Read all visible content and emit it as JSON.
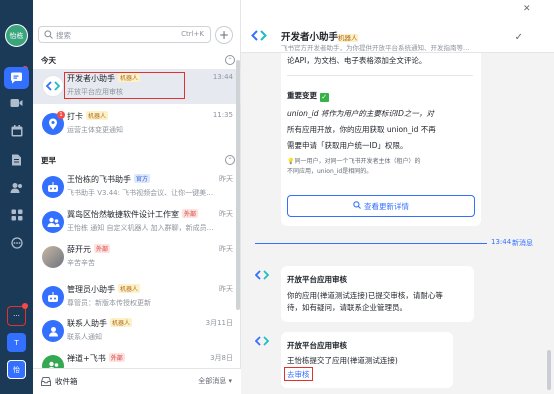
{
  "rail": {
    "avatar_text": "怡栋",
    "tile_t": "T",
    "tile_user": "怡"
  },
  "search": {
    "placeholder": "搜索",
    "shortcut": "Ctrl+K"
  },
  "sections": {
    "today": "今天",
    "earlier": "更早"
  },
  "conversations": [
    {
      "name": "开发者小助手",
      "tag": "机器人",
      "tag_type": "bot",
      "subtitle": "开放平台应用审核",
      "time": "13:44",
      "avatar_color": "#ffffff",
      "icon": "dev-assistant-logo-icon",
      "selected": true
    },
    {
      "name": "打卡",
      "tag": "机器人",
      "tag_type": "bot",
      "subtitle": "运营主体变更通知",
      "time": "11:35",
      "avatar_color": "#3370ff",
      "icon": "checkin-pin-icon",
      "badge": "1"
    },
    {
      "name": "王怡栋的飞书助手",
      "tag": "官方",
      "tag_type": "official",
      "subtitle": "飞书助手 V3.44: 飞书视频会议、让你一键美…",
      "time": "昨天",
      "avatar_color": "#3370ff",
      "icon": "robot-icon"
    },
    {
      "name": "冀岛区怡然敏捷软件设计工作室",
      "tag": "外部",
      "tag_type": "external",
      "subtitle": "王怡栋 通知 自定义机器人 加入群聊，新成员…",
      "time": "昨天",
      "avatar_color": "#3370ff",
      "icon": "group-icon"
    },
    {
      "name": "薛开元",
      "tag": "外部",
      "tag_type": "external",
      "subtitle": "辛苦辛苦",
      "time": "昨天",
      "avatar_color": "#8a8f99",
      "icon": "person-photo-icon"
    },
    {
      "name": "管理员小助手",
      "tag": "机器人",
      "tag_type": "bot",
      "subtitle": "尊管员：新版本传授权更新",
      "time": "昨天",
      "avatar_color": "#3370ff",
      "icon": "admin-robot-icon"
    },
    {
      "name": "联系人助手",
      "tag": "机器人",
      "tag_type": "bot",
      "subtitle": "联系人通知",
      "time": "3月11日",
      "avatar_color": "#3370ff",
      "icon": "contacts-icon"
    },
    {
      "name": "禅道+飞书",
      "tag": "外部",
      "tag_type": "external",
      "subtitle": "",
      "time": "3月8日",
      "avatar_color": "#34a853",
      "icon": "group-icon"
    }
  ],
  "footer": {
    "left": "收件箱",
    "right": "全部消息 ▾"
  },
  "chat": {
    "name": "开发者小助手",
    "tag": "机器人",
    "description": "飞书官方开发者助手，为你提供开放平台系统通知、开发指南等…"
  },
  "card1": {
    "line_top": "论API，为文档、电子表格添加全文评论。",
    "heading": "重要变更",
    "body_lines": [
      "union_id 将作为用户的主要标识ID之一，对",
      "所有应用开放，你的应用获取 union_id 不再",
      "需要申请「获取用户统一ID」权限。"
    ],
    "note_lines": [
      "💡同一用户，对同一个飞书开发者主体（租户）的",
      "不同应用，union_id是相同的。"
    ],
    "button": "查看更新详情"
  },
  "divider": {
    "time": "13:44",
    "label": "新消息"
  },
  "card2": {
    "title": "开放平台应用审核",
    "body_lines": [
      "你的应用(禅道测试连接)已提交审核，请耐心等",
      "待，如有疑问，请联系企业管理员。"
    ]
  },
  "card3": {
    "title": "开放平台应用审核",
    "body": "王怡栋提交了应用(禅道测试连接)",
    "link": "去审核"
  }
}
